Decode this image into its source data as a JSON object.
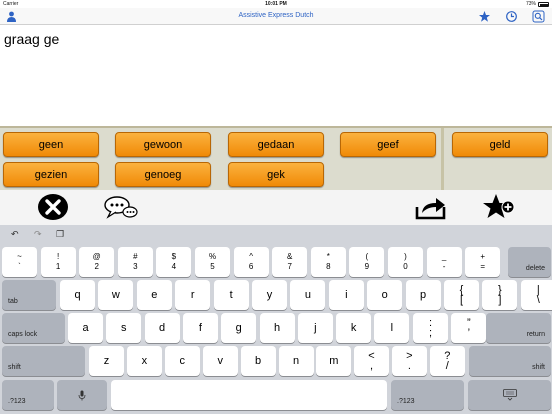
{
  "status": {
    "carrier": "Carrier",
    "time": "10:01 PM",
    "battery": "73%"
  },
  "nav": {
    "title": "Assistive Express Dutch"
  },
  "text": {
    "content": "graag ge"
  },
  "predictions": [
    "geen",
    "gewoon",
    "gedaan",
    "geef",
    "geld",
    "gezien",
    "genoeg",
    "gek"
  ],
  "keyboard": {
    "row1": [
      {
        "top": "~",
        "bottom": "`"
      },
      {
        "top": "!",
        "bottom": "1"
      },
      {
        "top": "@",
        "bottom": "2"
      },
      {
        "top": "#",
        "bottom": "3"
      },
      {
        "top": "$",
        "bottom": "4"
      },
      {
        "top": "%",
        "bottom": "5"
      },
      {
        "top": "^",
        "bottom": "6"
      },
      {
        "top": "&",
        "bottom": "7"
      },
      {
        "top": "*",
        "bottom": "8"
      },
      {
        "top": "(",
        "bottom": "9"
      },
      {
        "top": ")",
        "bottom": "0"
      },
      {
        "top": "_",
        "bottom": "-"
      },
      {
        "top": "+",
        "bottom": "="
      }
    ],
    "row2": [
      "q",
      "w",
      "e",
      "r",
      "t",
      "y",
      "u",
      "i",
      "o",
      "p"
    ],
    "row2_extra": [
      {
        "top": "{",
        "bottom": "["
      },
      {
        "top": "}",
        "bottom": "]"
      },
      {
        "top": "|",
        "bottom": "\\"
      }
    ],
    "row3": [
      "a",
      "s",
      "d",
      "f",
      "g",
      "h",
      "j",
      "k",
      "l"
    ],
    "row3_extra": [
      {
        "top": ":",
        "bottom": ";"
      },
      {
        "top": "”",
        "bottom": "’"
      }
    ],
    "row4": [
      "z",
      "x",
      "c",
      "v",
      "b",
      "n",
      "m"
    ],
    "row4_extra": [
      {
        "top": "<",
        "bottom": ","
      },
      {
        "top": ">",
        "bottom": "."
      },
      {
        "top": "?",
        "bottom": "/"
      }
    ],
    "delete": "delete",
    "tab": "tab",
    "caps": "caps lock",
    "return": "return",
    "shift_left": "shift",
    "shift_right": "shift",
    "num_left": ".?123",
    "num_right": ".?123"
  },
  "colors": {
    "accent": "#2e63c4",
    "prediction": "#f39a1a"
  }
}
